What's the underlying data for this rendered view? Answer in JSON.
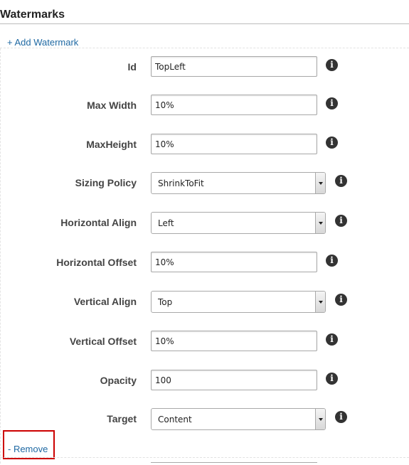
{
  "section": {
    "title": "Watermarks",
    "add_label": "+ Add Watermark",
    "remove_label": "- Remove"
  },
  "fields": {
    "id": {
      "label": "Id",
      "value": "TopLeft"
    },
    "max_width": {
      "label": "Max Width",
      "value": "10%"
    },
    "max_height": {
      "label": "MaxHeight",
      "value": "10%"
    },
    "sizing_policy": {
      "label": "Sizing Policy",
      "value": "ShrinkToFit"
    },
    "horizontal_align": {
      "label": "Horizontal Align",
      "value": "Left"
    },
    "horizontal_offset": {
      "label": "Horizontal Offset",
      "value": "10%"
    },
    "vertical_align": {
      "label": "Vertical Align",
      "value": "Top"
    },
    "vertical_offset": {
      "label": "Vertical Offset",
      "value": "10%"
    },
    "opacity": {
      "label": "Opacity",
      "value": "100"
    },
    "target": {
      "label": "Target",
      "value": "Content"
    }
  },
  "icons": {
    "info": "info-icon",
    "info_glyph": "i",
    "select_arrow": "chevron-down-icon"
  },
  "colors": {
    "link": "#1f69a3",
    "highlight": "#cc0000",
    "border": "#a9a9a9"
  }
}
